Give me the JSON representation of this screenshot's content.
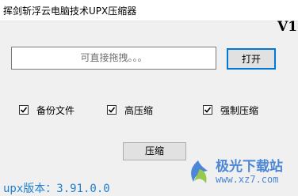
{
  "window": {
    "title": "挥剑斩浮云电脑技术UPX压缩器"
  },
  "header": {
    "version_label": "V1"
  },
  "input": {
    "placeholder": "可直接拖拽。。。"
  },
  "buttons": {
    "open": "打开",
    "compress": "压缩"
  },
  "options": [
    {
      "label": "备份文件",
      "checked": true
    },
    {
      "label": "高压缩",
      "checked": true
    },
    {
      "label": "强制压缩",
      "checked": true
    }
  ],
  "footer": {
    "upx_version": "upx版本：3.91.0.0"
  },
  "watermark": {
    "main": "极光下载站",
    "sub": "www.xz7.com"
  },
  "colors": {
    "accent": "#0078d7",
    "version_text": "#1e7fd0",
    "watermark": "#3a7bd5"
  }
}
